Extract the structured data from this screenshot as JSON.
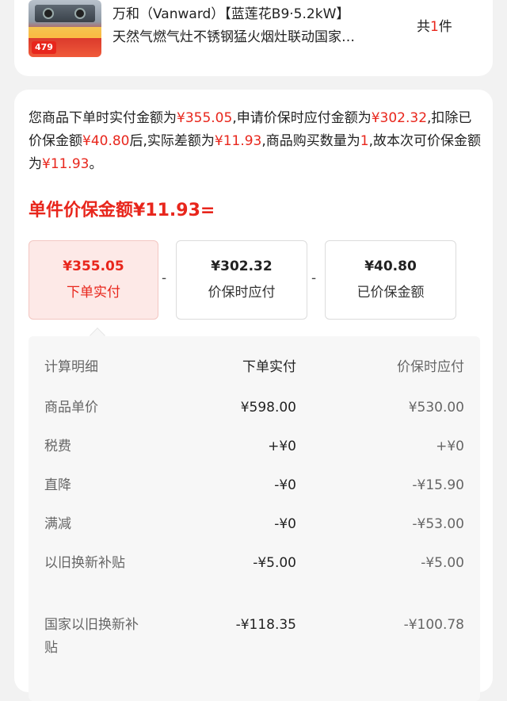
{
  "product": {
    "title_line1": "万和（Vanward）【蓝莲花B9·5.2kW】",
    "title_line2": "天然气燃气灶不锈钢猛火烟灶联动国家…",
    "qty_prefix": "共",
    "qty_num": "1",
    "qty_suffix": "件",
    "thumb_price": "479"
  },
  "summary": {
    "p1": "您商品下单时实付金额为",
    "v1": "¥355.05",
    "p2": ",申请价保时应付金额为",
    "v2": "¥302.32",
    "p3": ",扣除已价保金额",
    "v3": "¥40.80",
    "p4": "后,实际差额为",
    "v4": "¥11.93",
    "p5": ",商品购买数量为",
    "v5": "1",
    "p6": ",故本次可价保金额为",
    "v6": "¥11.93",
    "p7": "。"
  },
  "unit_title": "单件价保金额¥11.93=",
  "boxes": [
    {
      "amount": "¥355.05",
      "label": "下单实付"
    },
    {
      "amount": "¥302.32",
      "label": "价保时应付"
    },
    {
      "amount": "¥40.80",
      "label": "已价保金额"
    }
  ],
  "minus": "-",
  "table": {
    "headers": {
      "name": "计算明细",
      "col1": "下单实付",
      "col2": "价保时应付"
    },
    "rows": [
      {
        "name": "商品单价",
        "col1": "¥598.00",
        "col2": "¥530.00"
      },
      {
        "name": "税费",
        "col1": "+¥0",
        "col2": "+¥0"
      },
      {
        "name": "直降",
        "col1": "-¥0",
        "col2": "-¥15.90"
      },
      {
        "name": "满减",
        "col1": "-¥0",
        "col2": "-¥53.00"
      },
      {
        "name": "以旧换新补贴",
        "col1": "-¥5.00",
        "col2": "-¥5.00"
      },
      {
        "name": "国家以旧换新补贴",
        "col1": "-¥118.35",
        "col2": "-¥100.78"
      }
    ]
  },
  "colors": {
    "accent": "#e8261c",
    "active_bg": "#fde9e7",
    "table_bg": "#f7f7f7"
  }
}
